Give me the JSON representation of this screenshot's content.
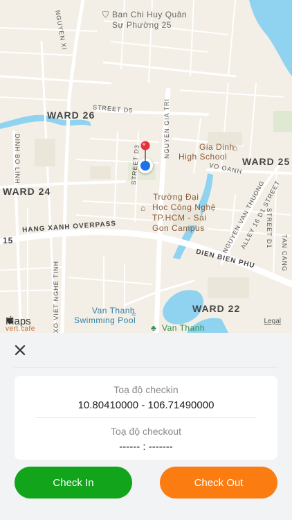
{
  "map": {
    "labels": {
      "ban_chi": "Ban Chi Huy Quân",
      "ban_chi_2": "Sự Phường 25",
      "nguyen_xi": "NGUYEN XI",
      "ward26": "WARD 26",
      "street_d5": "STREET D5",
      "nguyen_gia_tri": "NGUYEN GIA TRI",
      "gia_dinh": "Gia Dinh",
      "high_school": "High School",
      "ward25": "WARD 25",
      "vo_oanh": "VO OANH",
      "dinh_bo_linh": "DINH BO LINH",
      "street_d3": "STREET D3",
      "ward24": "WARD 24",
      "truong_1": "Trường Đại",
      "truong_2": "Học Công Nghệ",
      "truong_3": "TP.HCM - Sai",
      "truong_4": "Gon Campus",
      "nguyen_van_thuong": "NGUYEN VAN THUONG",
      "alley": "ALLEY 16 D1 STREET",
      "street_d1": "STREET D1",
      "tan_cang": "TAN CANG",
      "hang_xanh": "HANG XANH OVERPASS",
      "num15": "15",
      "dien_bien_phu": "DIEN BIEN PHU",
      "xo_viet": "XO VIET NGHE TINH",
      "van_thanh_1": "Van Thanh",
      "van_thanh_2": "Swimming Pool",
      "ward22": "WARD 22",
      "van_thanh_green": "Van Thanh",
      "cafe": "vert.cafe"
    },
    "attribution": "Maps",
    "legal": "Legal"
  },
  "panel": {
    "checkin_label": "Toạ độ checkin",
    "checkin_value": "10.80410000 - 106.71490000",
    "checkout_label": "Toạ độ checkout",
    "checkout_value": "------ : -------",
    "checkin_button": "Check In",
    "checkout_button": "Check Out"
  },
  "colors": {
    "checkin": "#12a51b",
    "checkout": "#fb7d12",
    "water": "#8fd3f0",
    "pin_red": "#e8303a",
    "location_blue": "#1a73e8"
  },
  "icons": {
    "close": "close-icon",
    "pin": "map-pin-icon",
    "location": "user-location-icon"
  }
}
